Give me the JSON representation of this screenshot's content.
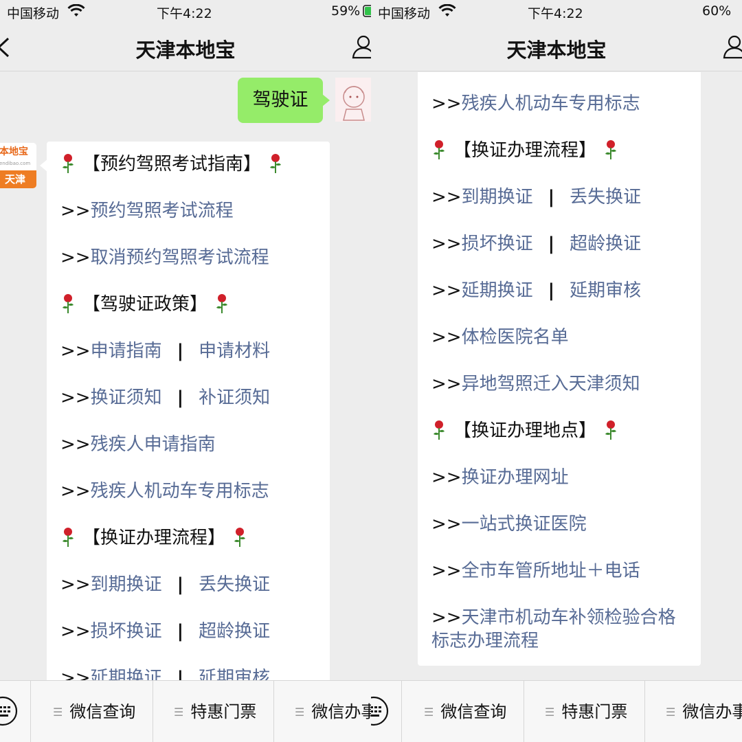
{
  "status_left": {
    "carrier": "中国移动",
    "time": "下午4:22",
    "battery": "59%"
  },
  "status_right": {
    "carrier": "中国移动",
    "time": "下午4:22",
    "battery": "60%"
  },
  "title": "天津本地宝",
  "sent_message": "驾驶证",
  "bot_avatar": {
    "top_text": "本地宝",
    "domain_text": "endibao.com",
    "bottom_text": "天津"
  },
  "card_left": {
    "h1": "【预约驾照考试指南】",
    "l1": "预约驾照考试流程",
    "l2": "取消预约驾照考试流程",
    "h2": "【驾驶证政策】",
    "l3a": "申请指南",
    "l3b": "申请材料",
    "l4a": "换证须知",
    "l4b": "补证须知",
    "l5": "残疾人申请指南",
    "l6": "残疾人机动车专用标志",
    "h3": "【换证办理流程】",
    "l7a": "到期换证",
    "l7b": "丢失换证",
    "l8a": "损坏换证",
    "l8b": "超龄换证",
    "l9a": "延期换证",
    "l9b": "延期审核"
  },
  "card_right": {
    "l1": "残疾人机动车专用标志",
    "h1": "【换证办理流程】",
    "l2a": "到期换证",
    "l2b": "丢失换证",
    "l3a": "损坏换证",
    "l3b": "超龄换证",
    "l4a": "延期换证",
    "l4b": "延期审核",
    "l5": "体检医院名单",
    "l6": "异地驾照迁入天津须知",
    "h2": "【换证办理地点】",
    "l7": "换证办理网址",
    "l8": "一站式换证医院",
    "l9": "全市车管所地址＋电话",
    "l10": "天津市机动车补领检验合格标志办理流程"
  },
  "arrow": ">>",
  "sep": "|",
  "menu": [
    "微信查询",
    "特惠门票",
    "微信办事"
  ],
  "colors": {
    "link": "#576b95",
    "bubble": "#95ec69",
    "brand": "#ee7d23",
    "rose": "#d0202a"
  },
  "icons": [
    "back-icon",
    "profile-icon",
    "wifi-icon",
    "battery-icon",
    "keyboard-icon",
    "rose-icon",
    "menu-icon"
  ]
}
